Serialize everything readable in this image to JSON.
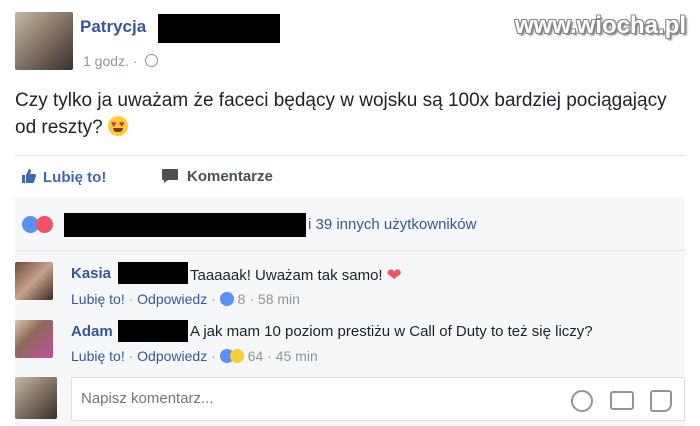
{
  "post": {
    "author": "Patrycja",
    "time": "1 godz. ·",
    "text": "Czy tylko ja uważam że faceci będący w wojsku są 100x bardziej pociągający od reszty?",
    "watermark": "www.wiocha.pl"
  },
  "actions": {
    "like": "Lubię to!",
    "comment": "Komentarze"
  },
  "reactions": {
    "summary": "i 39 innych użytkowników"
  },
  "comments": [
    {
      "author": "Kasia",
      "text": "Taaaaak! Uważam tak samo!",
      "like_label": "Lubię to!",
      "reply_label": "Odpowiedz",
      "sep": "·",
      "likes": "8",
      "time": "58 min"
    },
    {
      "author": "Adam",
      "text": "A jak mam 10 poziom prestiżu w Call of Duty to też się liczy?",
      "like_label": "Lubię to!",
      "reply_label": "Odpowiedz",
      "sep": "·",
      "likes": "64",
      "time": "45 min"
    }
  ],
  "composer": {
    "placeholder": "Napisz komentarz..."
  },
  "icons": [
    "globe-icon",
    "like-icon",
    "comment-icon",
    "love-icon",
    "heart-icon",
    "haha-icon",
    "emoji-icon",
    "camera-icon",
    "sticker-icon"
  ]
}
